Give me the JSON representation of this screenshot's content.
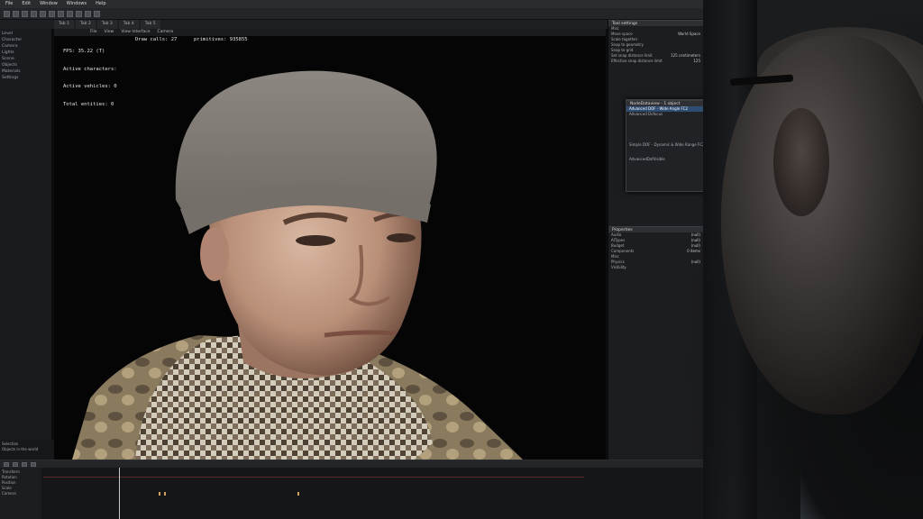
{
  "menubar": {
    "items": [
      "File",
      "Edit",
      "Window",
      "Windows",
      "Help"
    ]
  },
  "tabs": [
    "Tab 1",
    "Tab 2",
    "Tab 3",
    "Tab 4",
    "Tab 5"
  ],
  "outliner": {
    "rows": [
      "Level",
      "Character",
      "Camera",
      "Lights",
      "Scene",
      "Objects",
      "Materials",
      "Settings"
    ]
  },
  "viewport": {
    "tabs": [
      "File",
      "View",
      "View Interface",
      "Camera"
    ],
    "stats": {
      "fps": "FPS: 35.22 (T)",
      "active_characters": "Active characters:",
      "active_vehicles": "Active vehicles: 0",
      "total_entities": "Total entities: 0",
      "draw_calls": "Draw calls: 27",
      "primitives": "primitives: 935855"
    }
  },
  "right_panel": {
    "section1_title": "Tool settings",
    "section1_rows": [
      {
        "label": "Misc",
        "value": ""
      },
      {
        "label": "Move space",
        "value": "World Space"
      },
      {
        "label": "Scale together",
        "value": ""
      },
      {
        "label": "Snap to geometry",
        "value": ""
      },
      {
        "label": "Snap to grid",
        "value": ""
      },
      {
        "label": "Set snap distance limit",
        "value": "125 centimeters"
      },
      {
        "label": "Effective snap distance limit",
        "value": "125"
      }
    ],
    "section2_title": "Properties",
    "section2_rows": [
      {
        "label": "Audio",
        "value": "(null)"
      },
      {
        "label": "AITypes",
        "value": "(null)"
      },
      {
        "label": "Budget",
        "value": "(null)"
      },
      {
        "label": "Components",
        "value": "0 items"
      },
      {
        "label": "Misc",
        "value": ""
      },
      {
        "label": "Physics",
        "value": "(null)"
      },
      {
        "label": "Visibility",
        "value": ""
      }
    ]
  },
  "float_dialog": {
    "title": "NodeDataview - 1 object",
    "rows": [
      "Advanced DOF - Wide Angle FC2",
      "Advanced Defocus",
      "Simple DOF - Dynamic & Wide Range FC2",
      "AdvancedDofVisible"
    ]
  },
  "timeline": {
    "left_rows": [
      "Transform",
      "Rotation",
      "Position",
      "Scale",
      "Camera"
    ]
  },
  "bottom_left": {
    "rows": [
      "Selection",
      "Objects in the world"
    ]
  }
}
